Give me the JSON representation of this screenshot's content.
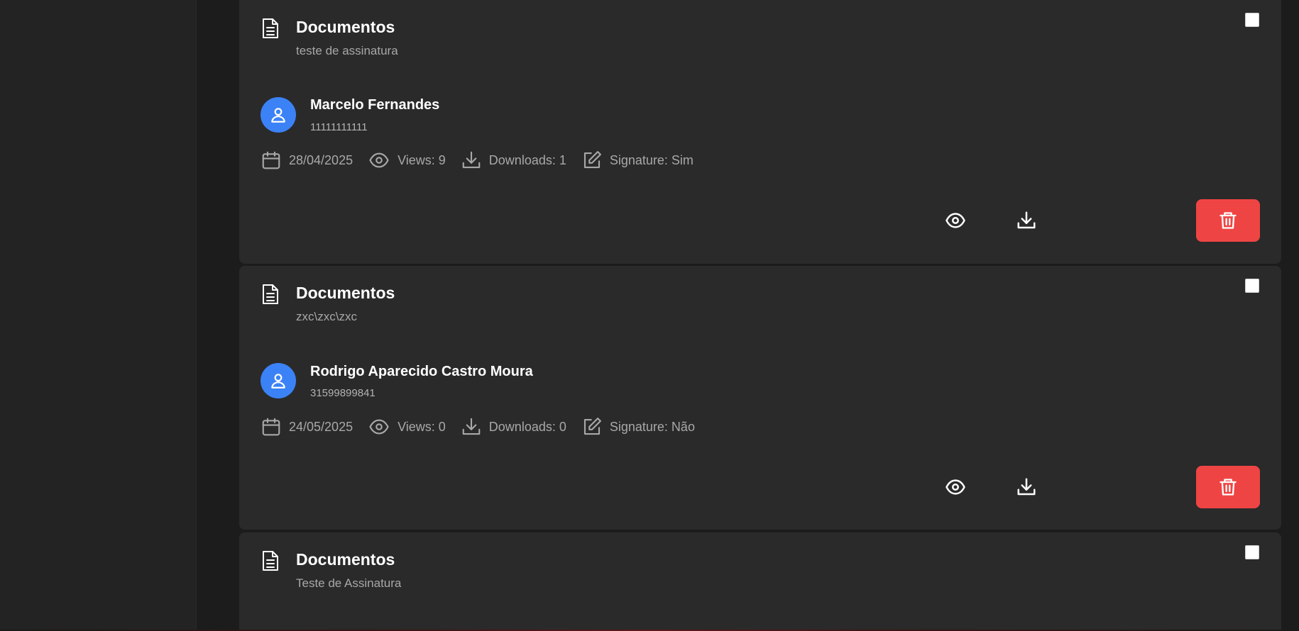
{
  "documents": [
    {
      "title": "Documentos",
      "description": "teste de assinatura",
      "user_name": "Marcelo Fernandes",
      "user_id": "11111111111",
      "date": "28/04/2025",
      "views": "Views: 9",
      "downloads": "Downloads: 1",
      "signature": "Signature: Sim"
    },
    {
      "title": "Documentos",
      "description": "zxc\\zxc\\zxc",
      "user_name": "Rodrigo Aparecido Castro Moura",
      "user_id": "31599899841",
      "date": "24/05/2025",
      "views": "Views: 0",
      "downloads": "Downloads: 0",
      "signature": "Signature: Não"
    },
    {
      "title": "Documentos",
      "description": "Teste de Assinatura"
    }
  ],
  "colors": {
    "accent_blue": "#3b82f6",
    "delete_red": "#ef4444",
    "card_bg": "#2a2a2a"
  }
}
